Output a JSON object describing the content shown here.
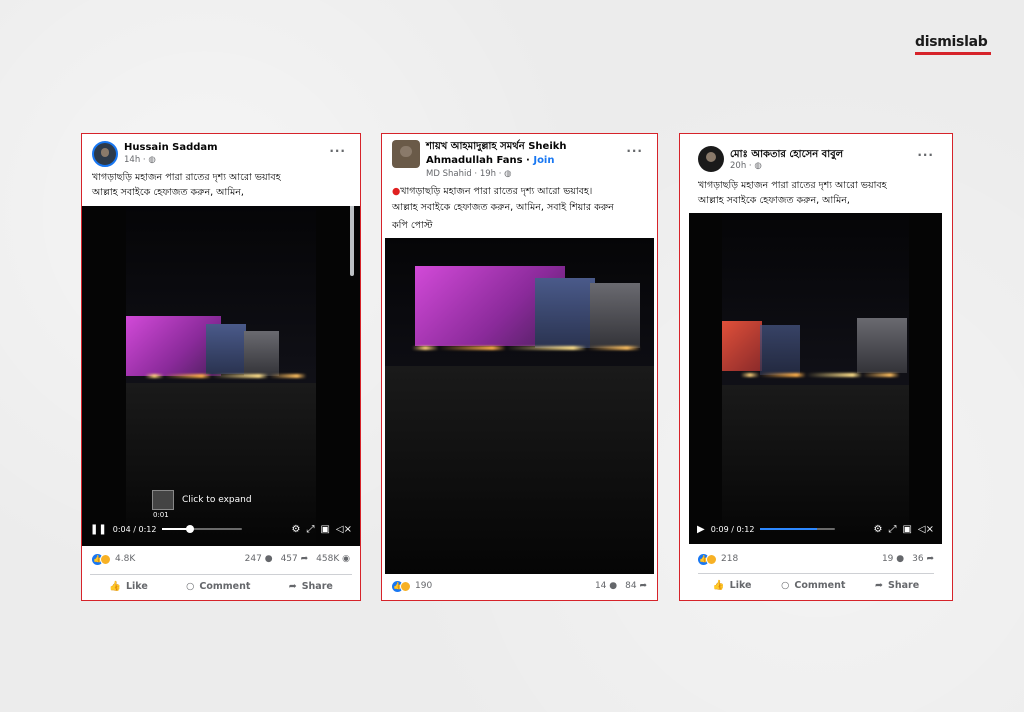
{
  "brand": {
    "logo_text": "dismislab",
    "accent": "#d6232a"
  },
  "posts": [
    {
      "author": "Hussain Saddam",
      "meta": "14h · ",
      "text_line1": "খাগড়াছড়ি মহাজন পারা রাতের দৃশ্য আরো ভয়াবহ",
      "text_line2": "আল্লাহ সবাইকে হেফাজত করুন, আমিন,",
      "time": "0:04 / 0:12",
      "progress": 0.33,
      "expand_time": "0:01",
      "expand_label": "Click to expand",
      "reactions": "4.8K",
      "comments": "247",
      "shares": "457",
      "views": "458K",
      "like": "Like",
      "comment": "Comment",
      "share": "Share"
    },
    {
      "author_line1": "শায়খ আহমাদুল্লাহ সমর্থন Sheikh",
      "author_line2": "Ahmadullah Fans",
      "join": "Join",
      "meta": "MD Shahid · 19h · ",
      "text_line1": "খাগড়াছড়ি মহাজন পারা রাতের দৃশ্য আরো ভয়াবহ।",
      "text_line2": "আল্লাহ সবাইকে হেফাজত করুন, আমিন, সবাই শিয়ার করুন",
      "text_line3": "কপি পোস্ট",
      "reactions": "190",
      "comments": "14",
      "shares": "84"
    },
    {
      "author": "মোঃ আকতার হোসেন বাবুল",
      "meta": "20h · ",
      "text_line1": "খাগড়াছড়ি মহাজন পারা রাতের দৃশ্য আরো ভয়াবহ",
      "text_line2": "আল্লাহ সবাইকে হেফাজত করুন, আমিন,",
      "time": "0:09 / 0:12",
      "progress": 0.75,
      "reactions": "218",
      "comments": "19",
      "shares": "36",
      "like": "Like",
      "comment": "Comment",
      "share": "Share"
    }
  ],
  "icons": [
    "globe-icon",
    "more-icon",
    "pause-icon",
    "play-icon",
    "settings-icon",
    "fullscreen-icon",
    "pip-icon",
    "mute-icon",
    "like-icon",
    "comment-icon",
    "share-icon",
    "views-icon"
  ]
}
